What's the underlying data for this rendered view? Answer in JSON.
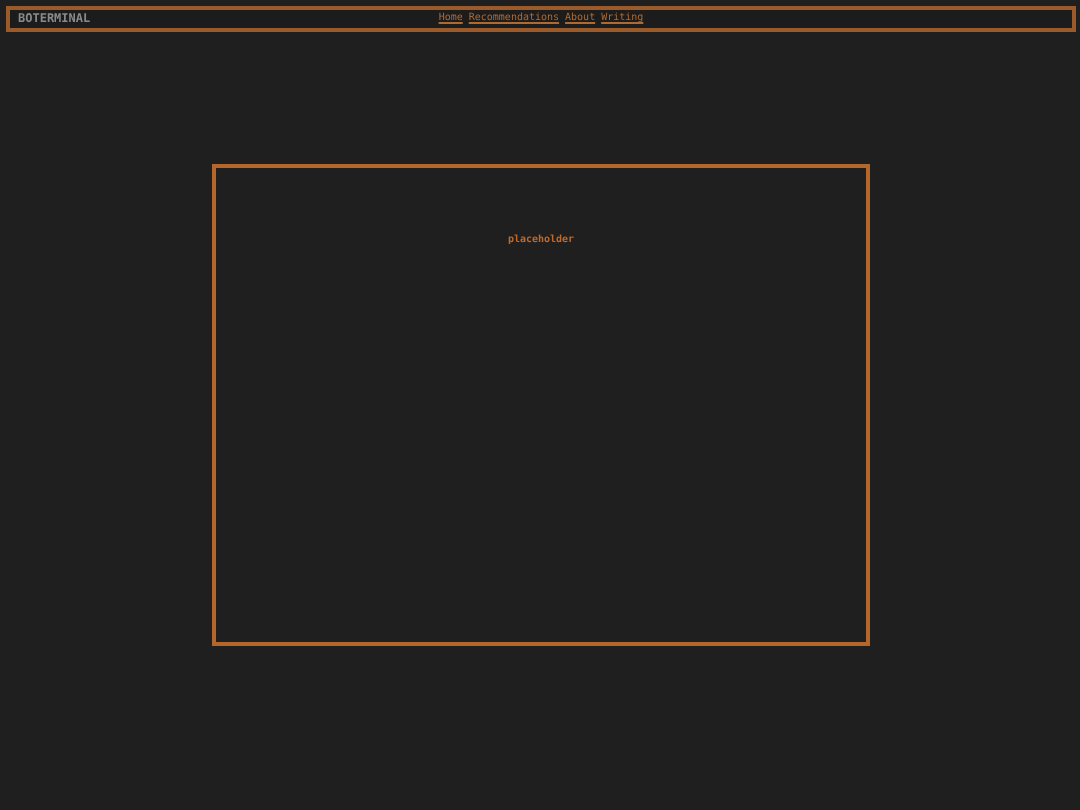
{
  "header": {
    "logo": "BOTERMINAL",
    "nav": [
      "Home",
      "Recommendations",
      "About",
      "Writing"
    ]
  },
  "panel": {
    "text": "placeholder"
  }
}
